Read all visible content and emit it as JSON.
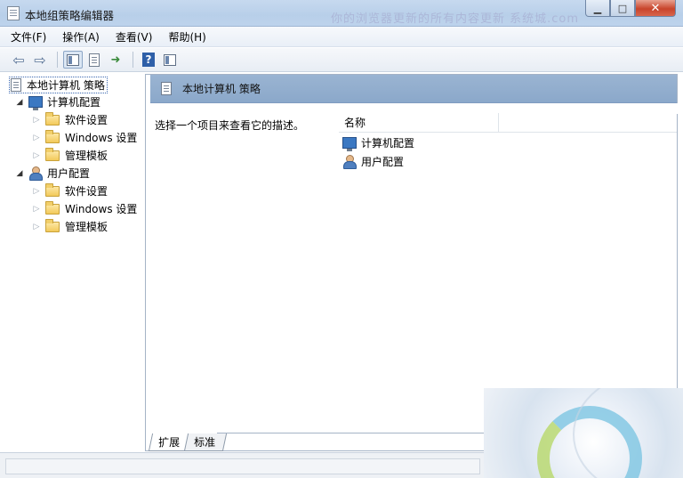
{
  "window": {
    "title": "本地组策略编辑器",
    "watermark": "你的浏览器更新的所有内容更新 系统城.com",
    "min_label": "▁",
    "max_label": "□",
    "close_label": "✕"
  },
  "menubar": {
    "items": [
      {
        "label": "文件(F)"
      },
      {
        "label": "操作(A)"
      },
      {
        "label": "查看(V)"
      },
      {
        "label": "帮助(H)"
      }
    ]
  },
  "toolbar": {
    "back_icon": "back-arrow-icon",
    "forward_icon": "forward-arrow-icon",
    "help_label": "?"
  },
  "tree": {
    "root": {
      "label": "本地计算机 策略"
    },
    "computer": {
      "label": "计算机配置",
      "children": [
        {
          "label": "软件设置"
        },
        {
          "label": "Windows 设置"
        },
        {
          "label": "管理模板"
        }
      ]
    },
    "user": {
      "label": "用户配置",
      "children": [
        {
          "label": "软件设置"
        },
        {
          "label": "Windows 设置"
        },
        {
          "label": "管理模板"
        }
      ]
    }
  },
  "right": {
    "header_title": "本地计算机 策略",
    "description": "选择一个项目来查看它的描述。",
    "column_name": "名称",
    "items": [
      {
        "label": "计算机配置",
        "icon": "computer-icon"
      },
      {
        "label": "用户配置",
        "icon": "user-icon"
      }
    ]
  },
  "tabs": [
    {
      "label": "扩展"
    },
    {
      "label": "标准"
    }
  ]
}
